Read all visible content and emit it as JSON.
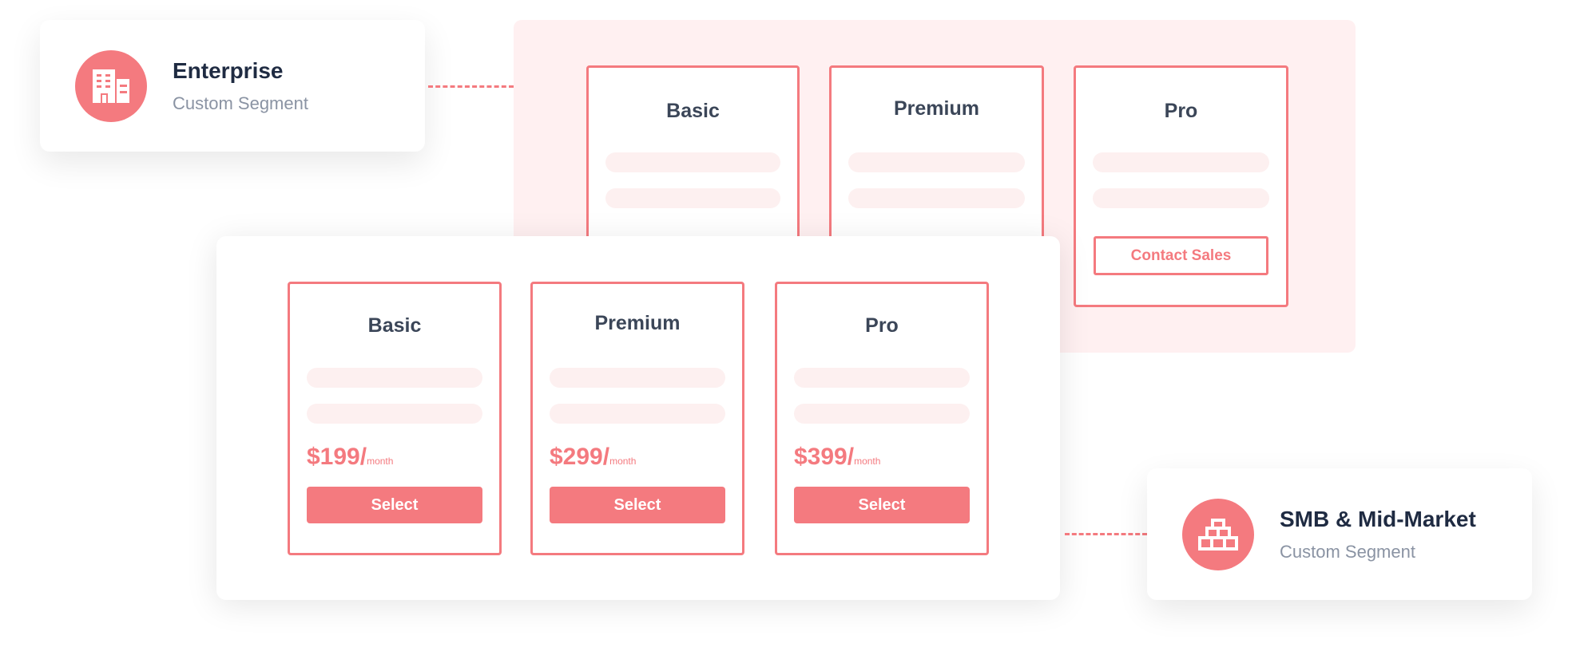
{
  "colors": {
    "accent": "#f47a7f",
    "tint": "#fff0f1",
    "text": "#1f2b42",
    "muted": "#8a93a3"
  },
  "enterprise": {
    "title": "Enterprise",
    "subtitle": "Custom Segment",
    "icon": "building-icon"
  },
  "smb": {
    "title": "SMB & Mid-Market",
    "subtitle": "Custom Segment",
    "icon": "bricks-icon"
  },
  "enterprise_plans": [
    {
      "name": "Basic"
    },
    {
      "name": "Premium"
    },
    {
      "name": "Pro",
      "button": "Contact Sales"
    }
  ],
  "smb_plans": [
    {
      "name": "Basic",
      "price": "$199/",
      "period": "month",
      "button": "Select"
    },
    {
      "name": "Premium",
      "price": "$299/",
      "period": "month",
      "button": "Select"
    },
    {
      "name": "Pro",
      "price": "$399/",
      "period": "month",
      "button": "Select"
    }
  ]
}
